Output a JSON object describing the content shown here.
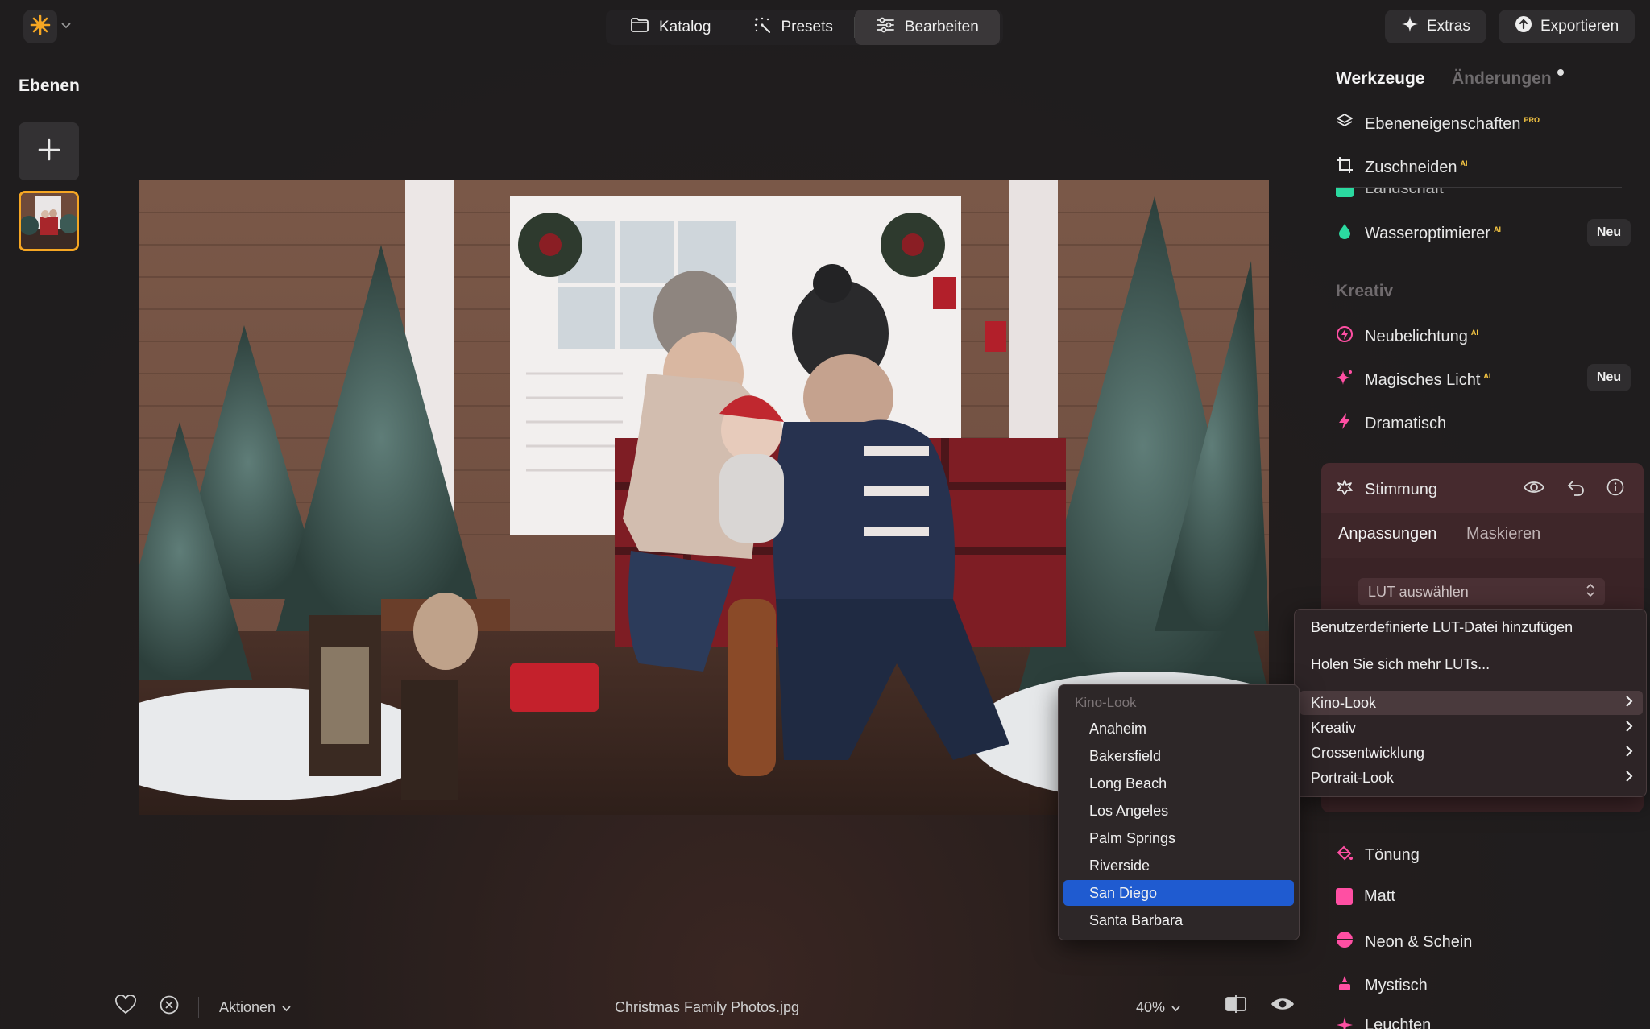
{
  "topbar": {
    "tabs": [
      {
        "label": "Katalog",
        "icon": "folder-icon"
      },
      {
        "label": "Presets",
        "icon": "sparkle-dots-icon"
      },
      {
        "label": "Bearbeiten",
        "icon": "sliders-icon"
      }
    ],
    "extras_label": "Extras",
    "export_label": "Exportieren"
  },
  "layers": {
    "title": "Ebenen"
  },
  "panel": {
    "tab_tools": "Werkzeuge",
    "tab_changes": "Änderungen",
    "tools_top": [
      {
        "label": "Ebeneneigenschaften",
        "tag": "PRO"
      },
      {
        "label": "Zuschneiden",
        "tag": "AI"
      }
    ],
    "partial_label": "Landschaft",
    "water": {
      "label": "Wasseroptimierer",
      "tag": "AI",
      "badge": "Neu"
    },
    "creative_head": "Kreativ",
    "creative_items": [
      {
        "label": "Neubelichtung",
        "tag": "AI"
      },
      {
        "label": "Magisches Licht",
        "tag": "AI",
        "badge": "Neu"
      },
      {
        "label": "Dramatisch",
        "tag": ""
      }
    ],
    "mood": {
      "title": "Stimmung",
      "tab_adjust": "Anpassungen",
      "tab_mask": "Maskieren",
      "lut_placeholder": "LUT auswählen"
    },
    "lower_items": [
      {
        "label": "Tönung"
      },
      {
        "label": "Matt"
      },
      {
        "label": "Neon & Schein"
      },
      {
        "label": "Mystisch"
      },
      {
        "label": "Leuchten"
      }
    ]
  },
  "lut_menu": {
    "add_custom": "Benutzerdefinierte LUT-Datei hinzufügen",
    "get_more": "Holen Sie sich mehr LUTs...",
    "categories": [
      "Kino-Look",
      "Kreativ",
      "Crossentwicklung",
      "Portrait-Look"
    ],
    "submenu_title": "Kino-Look",
    "submenu_items": [
      "Anaheim",
      "Bakersfield",
      "Long Beach",
      "Los Angeles",
      "Palm Springs",
      "Riverside",
      "San Diego",
      "Santa Barbara"
    ],
    "selected": "San Diego"
  },
  "bottombar": {
    "actions_label": "Aktionen",
    "filename": "Christmas Family Photos.jpg",
    "zoom": "40%"
  },
  "colors": {
    "accent_orange": "#f5a623",
    "selection_blue": "#1f5bd0",
    "mood_card": "#3a2326",
    "pink_icon": "#ff4fa3",
    "teal_icon": "#2bd9a0"
  }
}
